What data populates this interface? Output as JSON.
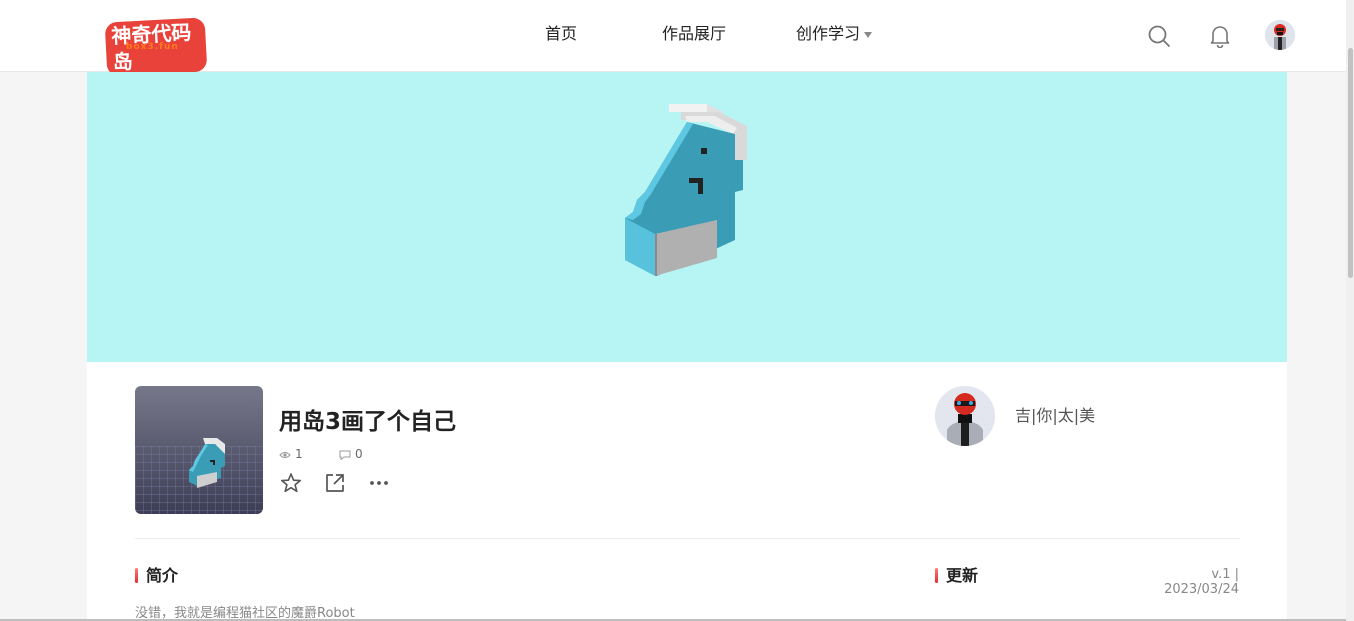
{
  "header": {
    "logo_text": "神奇代码岛",
    "logo_sub": "box3.fun",
    "nav": [
      {
        "label": "首页"
      },
      {
        "label": "作品展厅"
      },
      {
        "label": "创作学习"
      }
    ]
  },
  "project": {
    "title": "用岛3画了个自己",
    "views": "1",
    "comments": "0"
  },
  "author": {
    "name": "吉|你|太|美"
  },
  "sections": {
    "intro_title": "简介",
    "intro_text": "没错，我就是编程猫社区的魔爵Robot",
    "update_title": "更新",
    "version": "v.1 | 2023/03/24"
  },
  "colors": {
    "banner_bg": "#b7f5f5",
    "accent_red": "#e5282b",
    "character_blue": "#3a9db5"
  }
}
